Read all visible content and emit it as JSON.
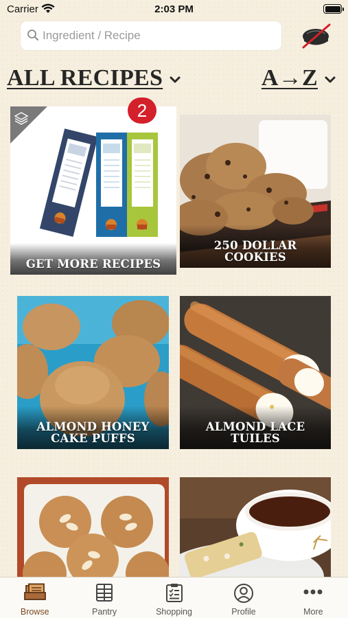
{
  "status_bar": {
    "carrier": "Carrier",
    "time": "2:03 PM"
  },
  "search": {
    "placeholder": "Ingredient / Recipe",
    "value": ""
  },
  "icons": {
    "search": "search-icon",
    "hat": "chef-hat-crossed-icon",
    "wifi": "wifi-icon",
    "battery": "battery-icon"
  },
  "filters": {
    "category": "ALL RECIPES",
    "sort": "A→Z"
  },
  "promo": {
    "badge": "2",
    "label": "GET MORE RECIPES"
  },
  "recipes": [
    {
      "title": "250 DOLLAR COOKIES"
    },
    {
      "title": "ALMOND HONEY CAKE PUFFS"
    },
    {
      "title": "ALMOND LACE TUILES"
    },
    {
      "title": ""
    },
    {
      "title": ""
    }
  ],
  "tabs": [
    {
      "label": "Browse",
      "icon": "browse-icon",
      "active": true
    },
    {
      "label": "Pantry",
      "icon": "pantry-icon",
      "active": false
    },
    {
      "label": "Shopping",
      "icon": "shopping-list-icon",
      "active": false
    },
    {
      "label": "Profile",
      "icon": "profile-icon",
      "active": false
    },
    {
      "label": "More",
      "icon": "more-icon",
      "active": false
    }
  ],
  "colors": {
    "background": "#f6efdf",
    "badge": "#d4202a",
    "active_tab": "#7a4a1e"
  }
}
